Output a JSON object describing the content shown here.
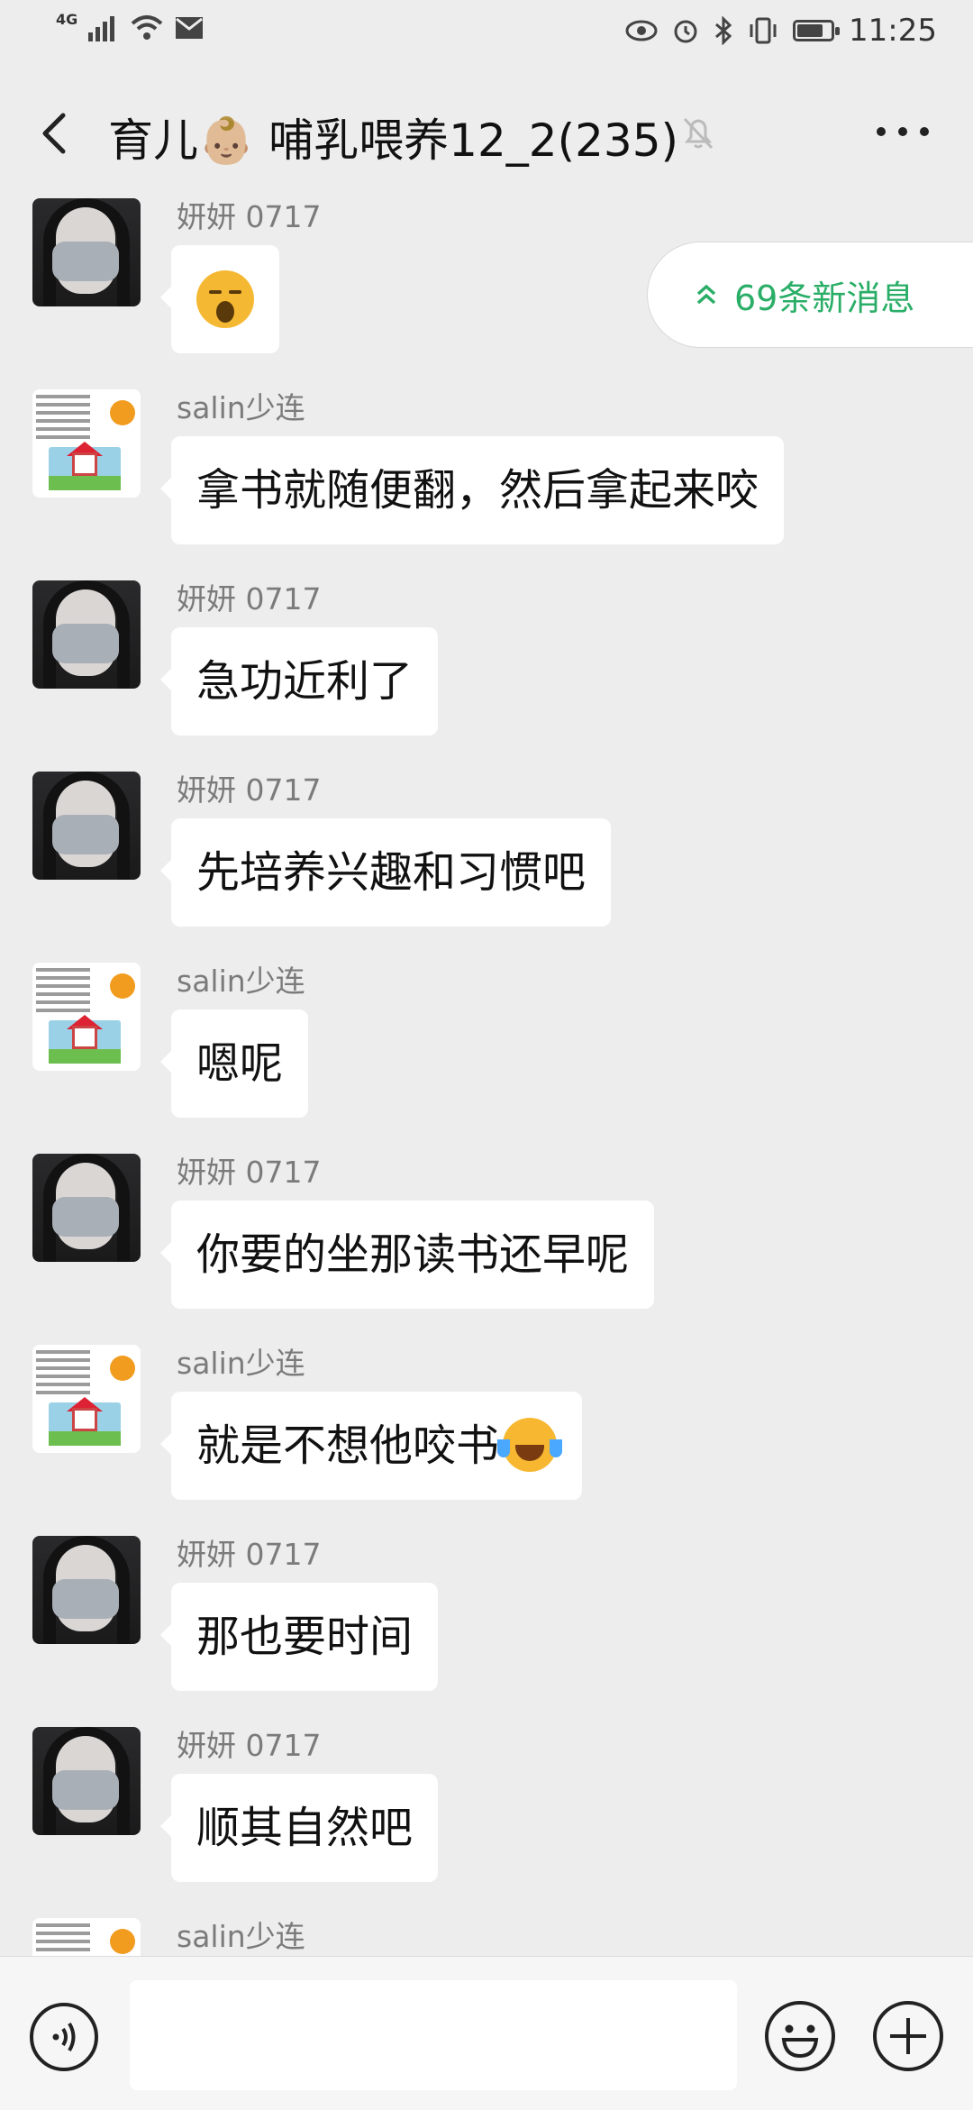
{
  "status": {
    "network": "4G",
    "time": "11:25"
  },
  "header": {
    "title": "育儿👶🏼 哺乳喂养12_2(235)"
  },
  "new_messages": {
    "label": "69条新消息"
  },
  "messages": [
    {
      "sender": "妍妍 0717",
      "text": ""
    },
    {
      "sender": "salin少连",
      "text": "拿书就随便翻，然后拿起来咬"
    },
    {
      "sender": "妍妍 0717",
      "text": "急功近利了"
    },
    {
      "sender": "妍妍 0717",
      "text": "先培养兴趣和习惯吧"
    },
    {
      "sender": "salin少连",
      "text": "嗯呢"
    },
    {
      "sender": "妍妍 0717",
      "text": "你要的坐那读书还早呢"
    },
    {
      "sender": "salin少连",
      "text": "就是不想他咬书"
    },
    {
      "sender": "妍妍 0717",
      "text": "那也要时间"
    },
    {
      "sender": "妍妍 0717",
      "text": "顺其自然吧"
    },
    {
      "sender": "salin少连",
      "text": ""
    }
  ],
  "icons": {
    "back": "back-arrow-icon",
    "mute": "bell-off-icon",
    "more": "more-icon",
    "voice": "voice-icon",
    "emoji": "emoji-icon",
    "plus": "plus-icon"
  }
}
